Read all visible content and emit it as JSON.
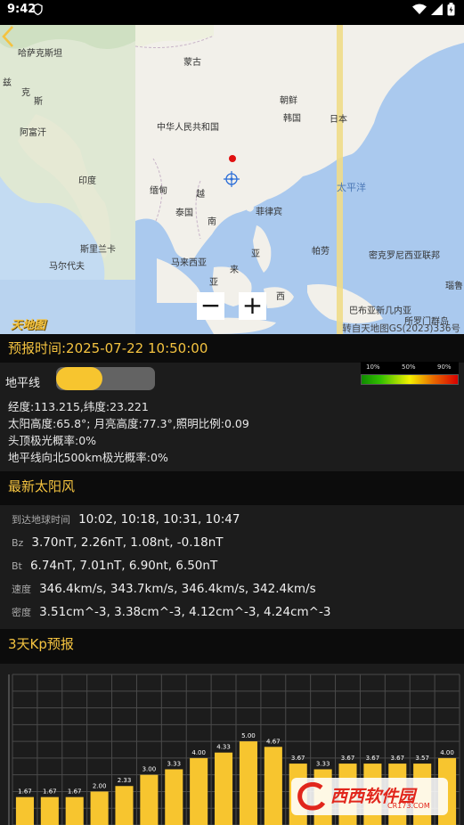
{
  "status_bar": {
    "time": "9:42"
  },
  "map": {
    "labels": [
      {
        "text": "哈萨克斯坦",
        "type": "land"
      },
      {
        "text": "蒙古",
        "type": "land"
      },
      {
        "text": "中华人民共和国",
        "type": "land"
      },
      {
        "text": "朝鲜",
        "type": "land"
      },
      {
        "text": "韩国",
        "type": "land"
      },
      {
        "text": "日本",
        "type": "land"
      },
      {
        "text": "阿富汗",
        "type": "land"
      },
      {
        "text": "印度",
        "type": "land"
      },
      {
        "text": "缅甸",
        "type": "land"
      },
      {
        "text": "泰国",
        "type": "land"
      },
      {
        "text": "越",
        "type": "land"
      },
      {
        "text": "南",
        "type": "land"
      },
      {
        "text": "菲律宾",
        "type": "land"
      },
      {
        "text": "太平洋",
        "type": "sea"
      },
      {
        "text": "斯里兰卡",
        "type": "land"
      },
      {
        "text": "马尔代夫",
        "type": "land"
      },
      {
        "text": "马来西亚",
        "type": "land"
      },
      {
        "text": "帕劳",
        "type": "land"
      },
      {
        "text": "密克罗尼西亚联邦",
        "type": "land"
      },
      {
        "text": "巴布亚新几内亚",
        "type": "land"
      },
      {
        "text": "所罗门群岛",
        "type": "land"
      },
      {
        "text": "瑙鲁",
        "type": "land"
      },
      {
        "text": "克",
        "type": "land"
      },
      {
        "text": "斯",
        "type": "land"
      },
      {
        "text": "兹",
        "type": "land"
      },
      {
        "text": "亚",
        "type": "land"
      },
      {
        "text": "来",
        "type": "land"
      },
      {
        "text": "西",
        "type": "land"
      },
      {
        "text": "亚",
        "type": "land"
      }
    ],
    "logo": "天地图",
    "attribution": "转自天地图GS(2023)336号",
    "zoom_out_label": "−",
    "zoom_in_label": "+"
  },
  "forecast": {
    "title": "预报时间:2025-07-22 10:50:00",
    "horizon_label": "地平线",
    "horizon_toggle_on": true,
    "legend": [
      "10%",
      "50%",
      "90%"
    ],
    "lines": [
      "经度:113.215,纬度:23.221",
      "太阳高度:65.8°; 月亮高度:77.3°,照明比例:0.09",
      "头顶极光概率:0%",
      "地平线向北500km极光概率:0%"
    ]
  },
  "solar_wind": {
    "title": "最新太阳风",
    "rows": [
      {
        "key": "到达地球时间",
        "value": "10:02, 10:18, 10:31, 10:47"
      },
      {
        "key": "Bz",
        "value": "3.70nT, 2.26nT, 1.08nt, -0.18nT"
      },
      {
        "key": "Bt",
        "value": "6.74nT, 7.01nT, 6.90nt, 6.50nT"
      },
      {
        "key": "速度",
        "value": "346.4km/s, 343.7km/s, 346.4km/s, 342.4km/s"
      },
      {
        "key": "密度",
        "value": "3.51cm^-3, 3.38cm^-3, 4.12cm^-3, 4.24cm^-3"
      }
    ]
  },
  "kp": {
    "title": "3天Kp预报"
  },
  "chart_data": {
    "type": "bar",
    "title": "",
    "xlabel": "",
    "ylabel": "",
    "ylim": [
      0,
      9
    ],
    "grid": true,
    "bar_color": "#f7c52f",
    "values": [
      1.67,
      1.67,
      1.67,
      2.0,
      2.33,
      3.0,
      3.33,
      4.0,
      4.33,
      5.0,
      4.67,
      3.67,
      3.33,
      3.67,
      3.67,
      3.67,
      3.67,
      4.0
    ],
    "labels": [
      "1.67",
      "1.67",
      "1.67",
      "2.00",
      "2.33",
      "3.00",
      "3.33",
      "4.00",
      "4.33",
      "5.00",
      "4.67",
      "3.67",
      "3.33",
      "3.67",
      "3.67",
      "3.67",
      "3.57",
      "4.00"
    ]
  },
  "watermark": {
    "text": "西西软件园",
    "sub": "CR173.COM"
  },
  "colors": {
    "accent": "#f4c340",
    "panel": "#1c1c1c",
    "header": "#0c0c0c"
  }
}
